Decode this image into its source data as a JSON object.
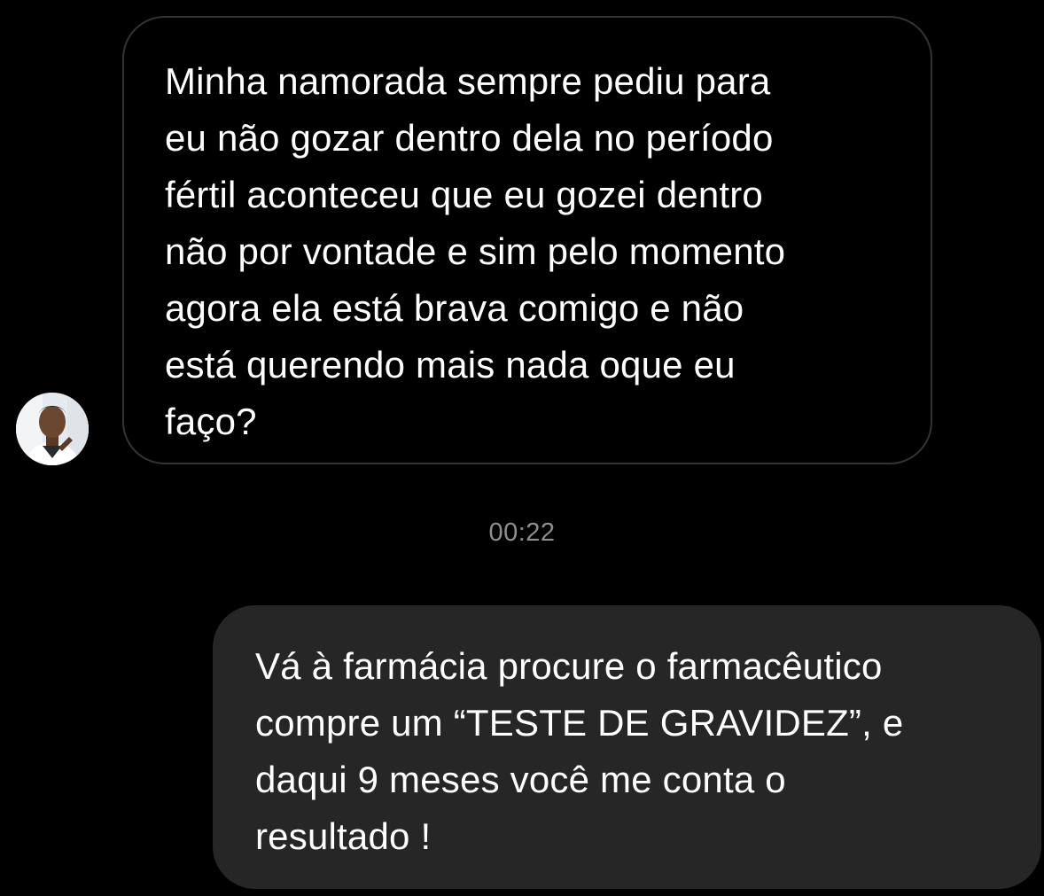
{
  "conversation": {
    "incoming_message": {
      "text": "Minha namorada sempre pediu para\neu não gozar dentro dela no período\nfértil aconteceu que eu gozei dentro\nnão por vontade e sim pelo momento\nagora ela está brava comigo e não\nestá querendo mais nada oque eu\nfaço?",
      "sender_avatar": "profile-photo-icon"
    },
    "timestamp": "00:22",
    "outgoing_message": {
      "text": "Vá à farmácia procure o farmacêutico\ncompre um “TESTE DE GRAVIDEZ”, e\ndaqui 9 meses você me conta o\nresultado !"
    }
  },
  "colors": {
    "background": "#000000",
    "incoming_border": "#333333",
    "outgoing_fill": "#262626",
    "timestamp": "#8e8e8e",
    "text": "#ffffff"
  }
}
